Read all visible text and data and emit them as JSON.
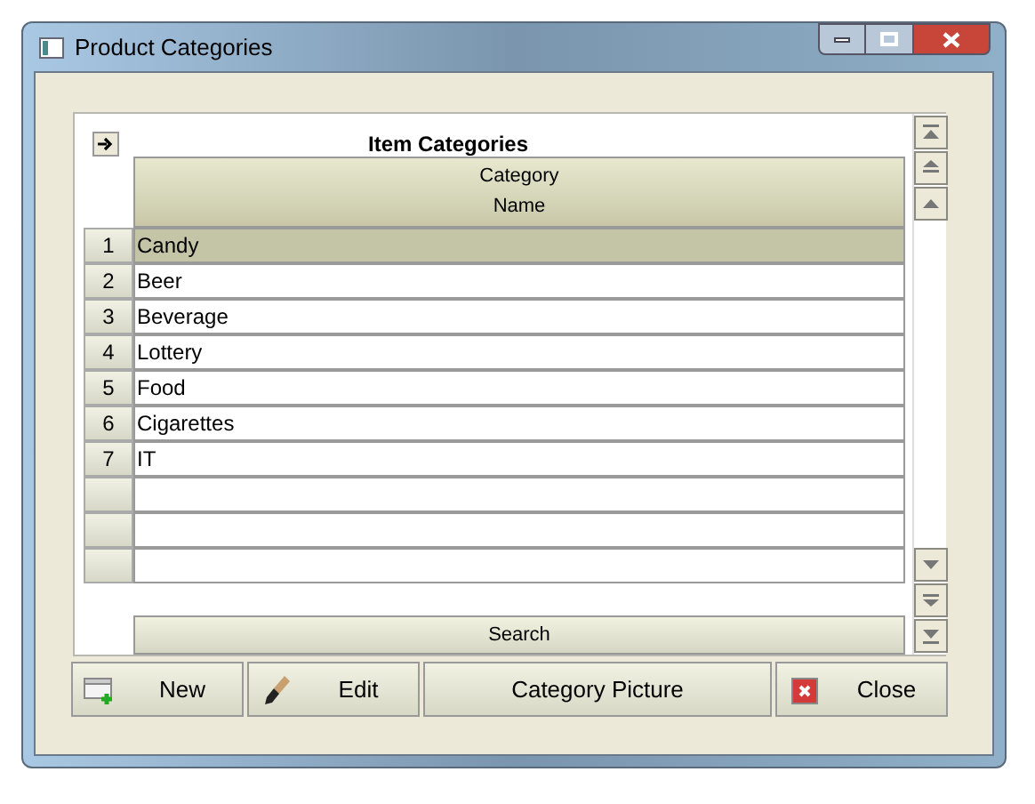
{
  "window": {
    "title": "Product Categories"
  },
  "grid": {
    "title": "Item Categories",
    "header_lines": [
      "Category",
      "Name"
    ],
    "rows": [
      {
        "number": "1",
        "name": "Candy",
        "selected": true
      },
      {
        "number": "2",
        "name": "Beer",
        "selected": false
      },
      {
        "number": "3",
        "name": "Beverage",
        "selected": false
      },
      {
        "number": "4",
        "name": "Lottery",
        "selected": false
      },
      {
        "number": "5",
        "name": "Food",
        "selected": false
      },
      {
        "number": "6",
        "name": "Cigarettes",
        "selected": false
      },
      {
        "number": "7",
        "name": "IT",
        "selected": false
      }
    ],
    "search_button": "Search"
  },
  "buttons": [
    {
      "kind": "new",
      "label": "New"
    },
    {
      "kind": "edit",
      "label": "Edit"
    },
    {
      "kind": "plain",
      "label": "Category Picture"
    },
    {
      "kind": "close",
      "label": "Close"
    }
  ]
}
